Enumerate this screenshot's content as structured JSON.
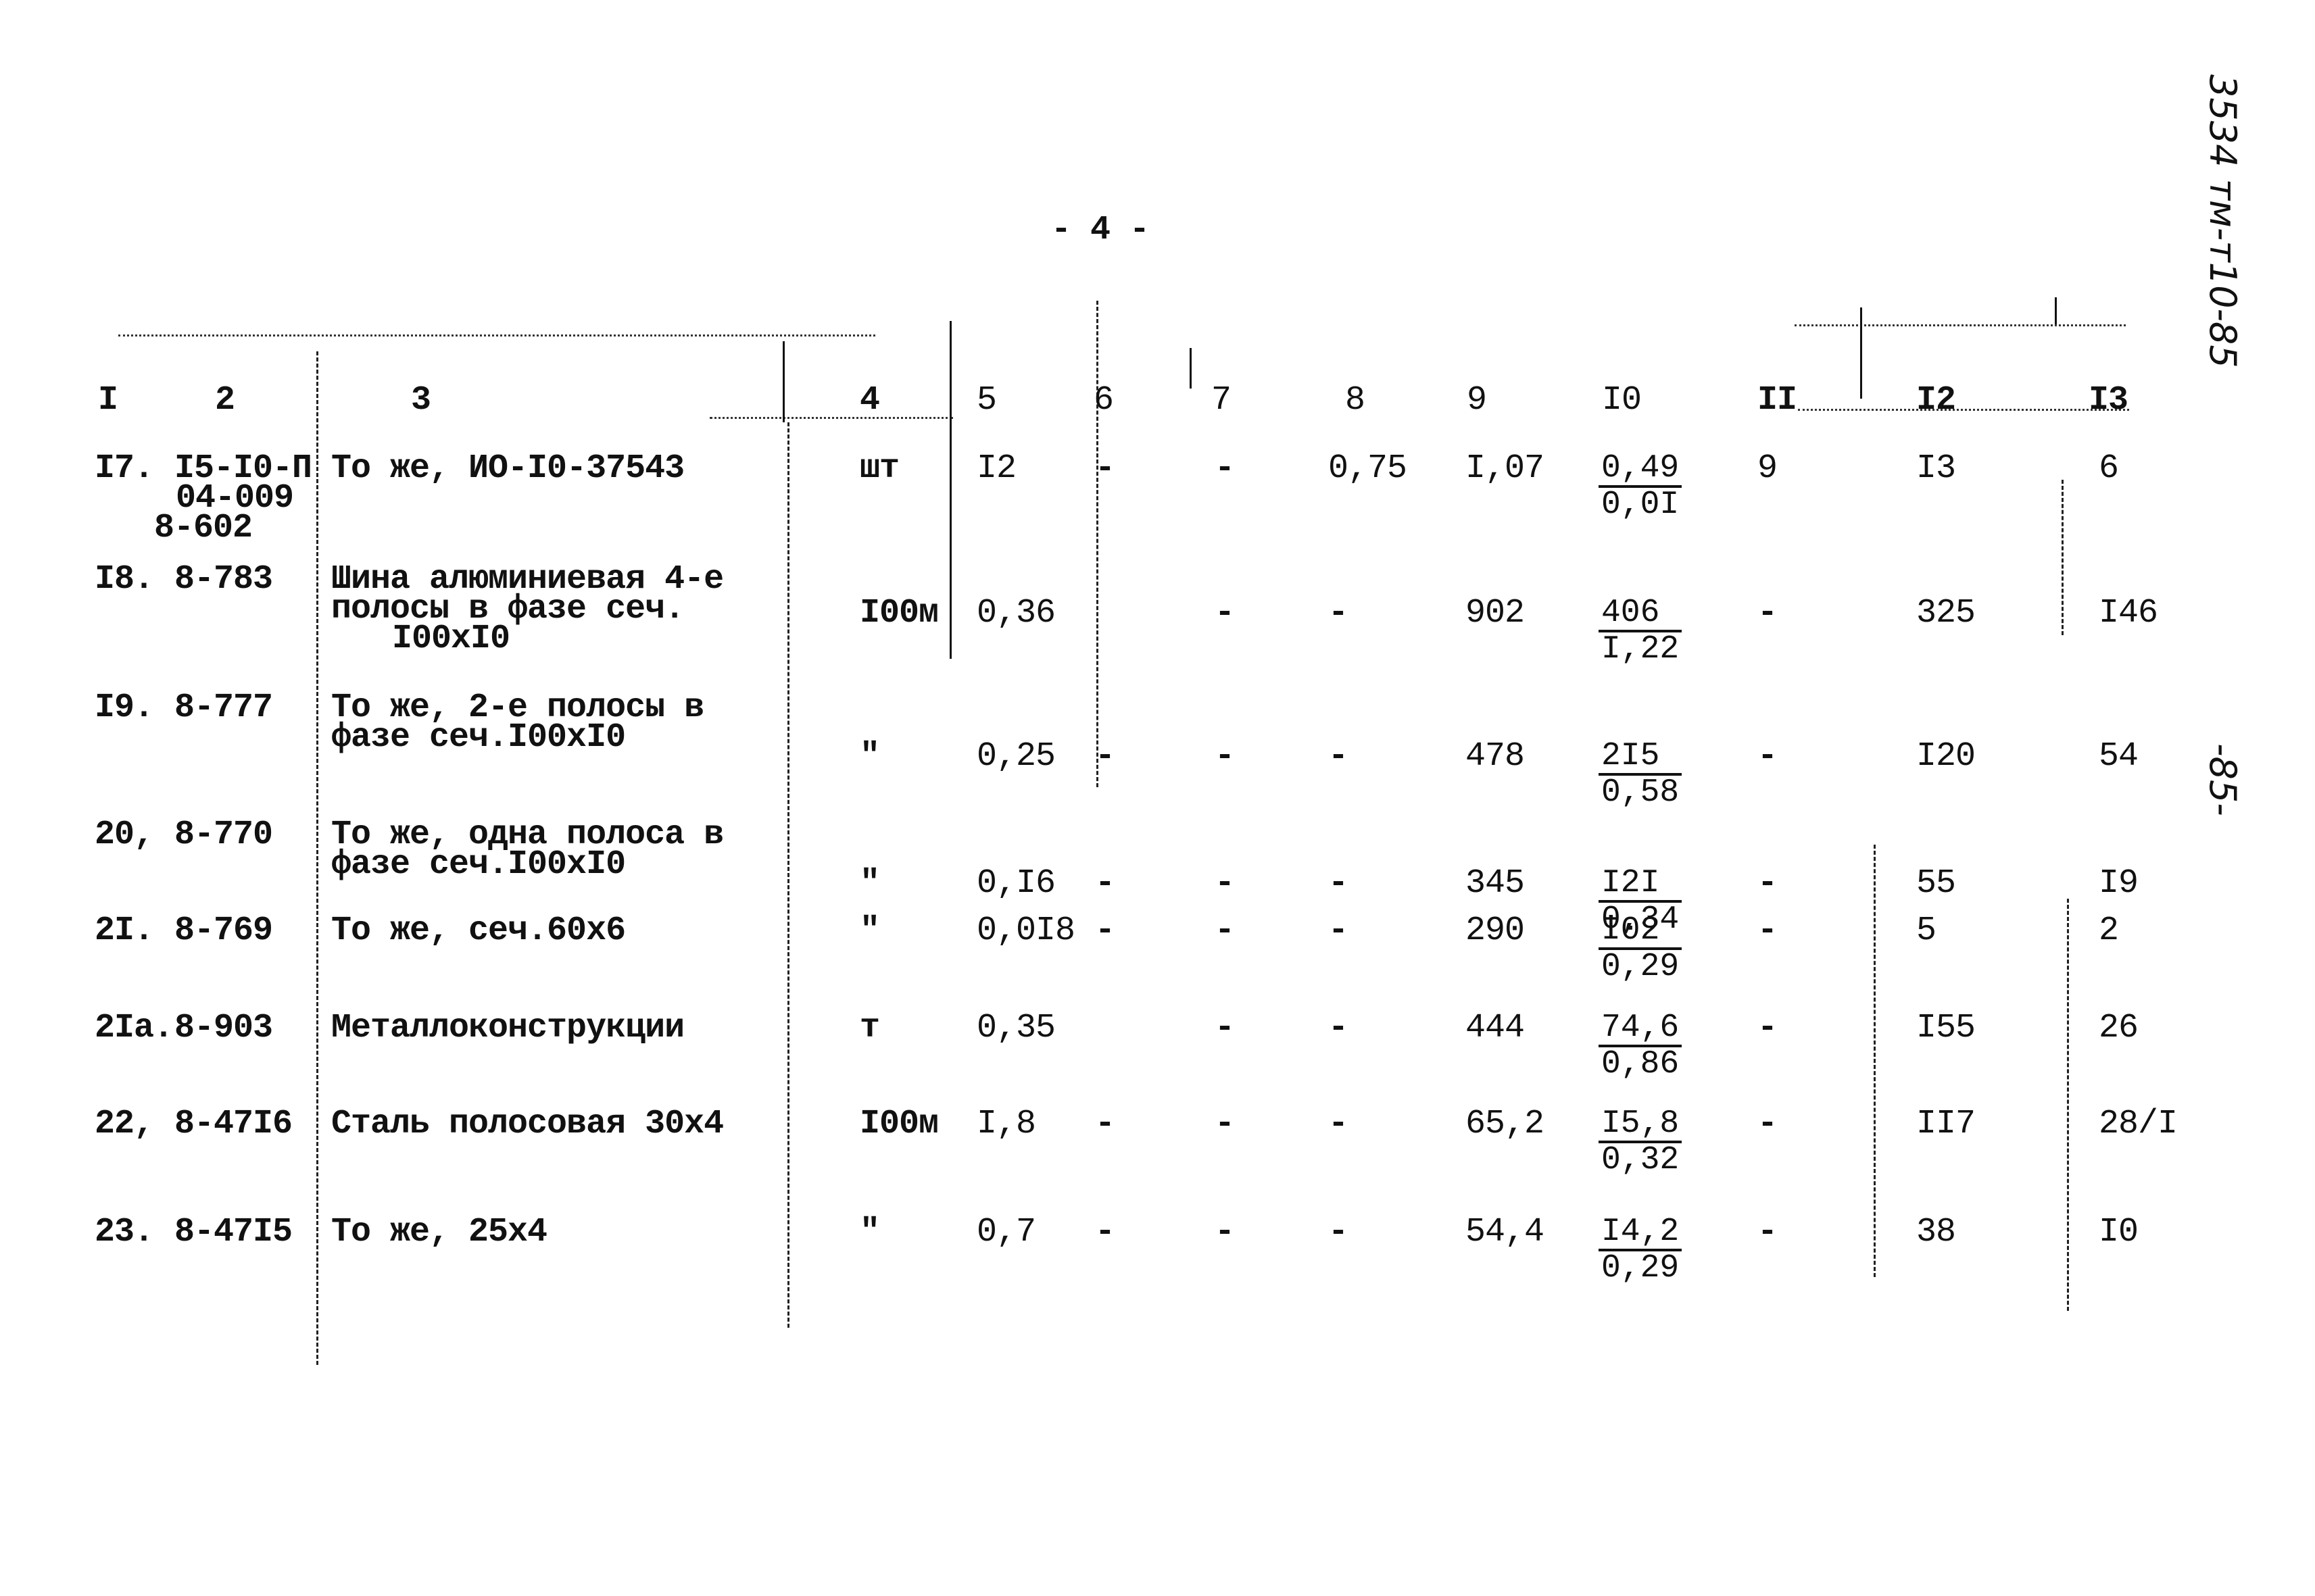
{
  "page": {
    "page_number": "- 4 -",
    "side_annotation_top": "3534 тм-т10-85",
    "side_annotation_mid": "-85-"
  },
  "table": {
    "column_headers": [
      "I",
      "2",
      "3",
      "4",
      "5",
      "6",
      "7",
      "8",
      "9",
      "I0",
      "II",
      "I2",
      "I3"
    ],
    "rows": [
      {
        "num": "I7.",
        "code": [
          "I5-I0-П",
          "04-009",
          "8-602"
        ],
        "name": [
          "То же, ИО-I0-37543"
        ],
        "unit": "шт",
        "c5": "I2",
        "c6": "-",
        "c7": "-",
        "c8": "0,75",
        "c9": "I,07",
        "c10_num": "0,49",
        "c10_den": "0,0I",
        "c11": "9",
        "c12": "I3",
        "c13": "6"
      },
      {
        "num": "I8.",
        "code": [
          "8-783"
        ],
        "name": [
          "Шина алюминиевая 4-е",
          "полосы в фазе сеч.",
          "I00xI0"
        ],
        "unit": "I00м",
        "c5": "0,36",
        "c6": "",
        "c7": "-",
        "c8": "-",
        "c9": "902",
        "c10_num": "406",
        "c10_den": "I,22",
        "c11": "-",
        "c12": "325",
        "c13": "I46"
      },
      {
        "num": "I9.",
        "code": [
          "8-777"
        ],
        "name": [
          "То же, 2-е полосы в",
          "фазе сеч.I00xI0"
        ],
        "unit": "\"",
        "c5": "0,25",
        "c6": "-",
        "c7": "-",
        "c8": "-",
        "c9": "478",
        "c10_num": "2I5",
        "c10_den": "0,58",
        "c11": "-",
        "c12": "I20",
        "c13": "54"
      },
      {
        "num": "20,",
        "code": [
          "8-770"
        ],
        "name": [
          "То же, одна полоса в",
          "фазе сеч.I00xI0"
        ],
        "unit": "\"",
        "c5": "0,I6",
        "c6": "-",
        "c7": "-",
        "c8": "-",
        "c9": "345",
        "c10_num": "I2I",
        "c10_den": "0,34",
        "c11": "-",
        "c12": "55",
        "c13": "I9"
      },
      {
        "num": "2I.",
        "code": [
          "8-769"
        ],
        "name": [
          "То же, сеч.60x6"
        ],
        "unit": "\"",
        "c5": "0,0I8",
        "c6": "-",
        "c7": "-",
        "c8": "-",
        "c9": "290",
        "c10_num": "I02",
        "c10_den": "0,29",
        "c11": "-",
        "c12": "5",
        "c13": "2"
      },
      {
        "num": "2Iа.",
        "code": [
          "8-903"
        ],
        "name": [
          "Металлоконструкции"
        ],
        "unit": "т",
        "c5": "0,35",
        "c6": "",
        "c7": "-",
        "c8": "-",
        "c9": "444",
        "c10_num": "74,6",
        "c10_den": "0,86",
        "c11": "-",
        "c12": "I55",
        "c13": "26"
      },
      {
        "num": "22,",
        "code": [
          "8-47I6"
        ],
        "name": [
          "Сталь полосовая 30x4"
        ],
        "unit": "I00м",
        "c5": "I,8",
        "c6": "-",
        "c7": "-",
        "c8": "-",
        "c9": "65,2",
        "c10_num": "I5,8",
        "c10_den": "0,32",
        "c11": "-",
        "c12": "II7",
        "c13": "28/I"
      },
      {
        "num": "23.",
        "code": [
          "8-47I5"
        ],
        "name": [
          "То же, 25x4"
        ],
        "unit": "\"",
        "c5": "0,7",
        "c6": "-",
        "c7": "-",
        "c8": "-",
        "c9": "54,4",
        "c10_num": "I4,2",
        "c10_den": "0,29",
        "c11": "-",
        "c12": "38",
        "c13": "I0"
      }
    ]
  }
}
